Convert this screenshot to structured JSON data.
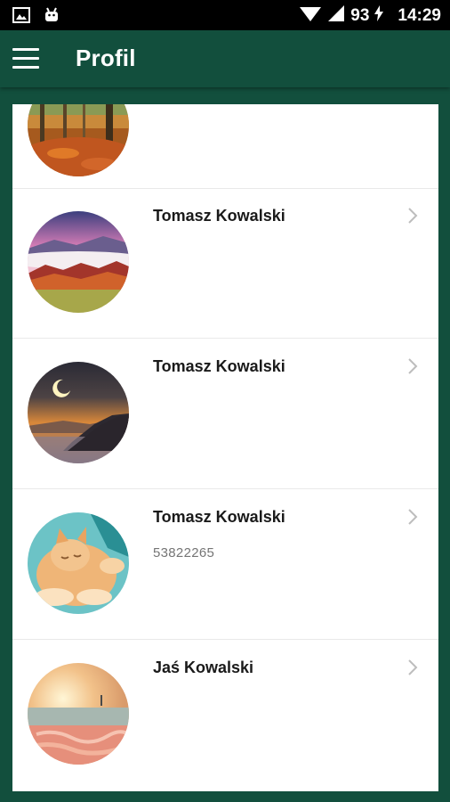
{
  "statusbar": {
    "battery": "93",
    "time": "14:29",
    "icons": [
      "image-icon",
      "android-icon",
      "wifi-icon",
      "signal-icon",
      "battery-charging-icon"
    ]
  },
  "appbar": {
    "title": "Profil",
    "menu_icon": "hamburger-menu-icon"
  },
  "profiles": [
    {
      "name": "",
      "number": "",
      "avatar": "autumn-forest"
    },
    {
      "name": "Tomasz Kowalski",
      "number": "",
      "avatar": "mountain-sunset"
    },
    {
      "name": "Tomasz Kowalski",
      "number": "",
      "avatar": "moon-lake"
    },
    {
      "name": "Tomasz Kowalski",
      "number": "53822265",
      "avatar": "sleeping-cat"
    },
    {
      "name": "Jaś Kowalski",
      "number": "",
      "avatar": "beach-sunrise"
    }
  ],
  "colors": {
    "appbar": "#124f3d",
    "statusbar": "#000000",
    "card": "#ffffff",
    "chevron": "#bdbdbd"
  }
}
